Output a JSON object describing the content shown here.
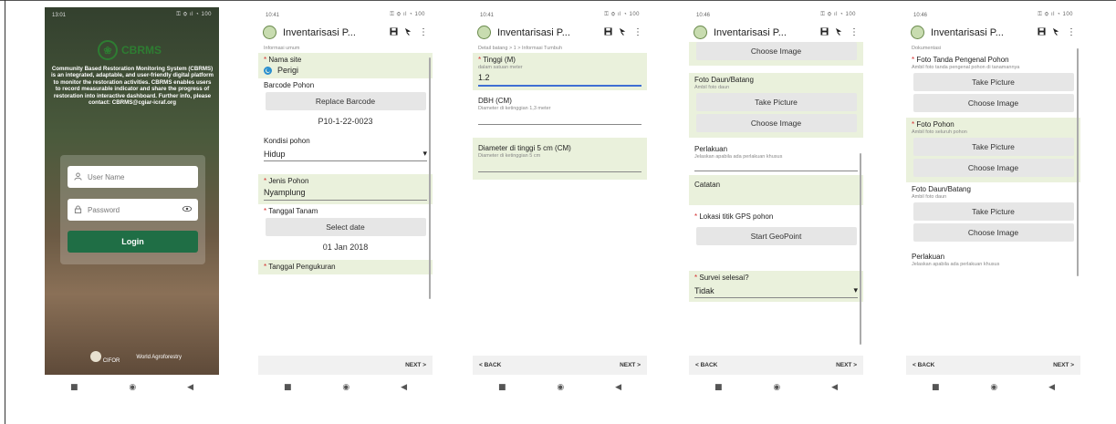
{
  "phones": {
    "login": {
      "status_time": "13:01",
      "status_icons": "⚿ ⚙ ıl ◔ 100",
      "brand_name": "CBRMS",
      "brand_mark": "❀",
      "description": "Community Based Restoration Monitoring System (CBRMS) is an integrated, adaptable, and user-friendly digital platform to monitor the restoration activities. CBRMS enables users to record measurable indicator and share the progress of restoration into interactive dashboard. Further info, please contact: CBRMS@cgiar-icraf.org",
      "username_placeholder": "User Name",
      "password_placeholder": "Password",
      "login_label": "Login",
      "logo_left": "CIFOR",
      "logo_right": "World Agroforestry",
      "user_icon": "person-icon",
      "lock_icon": "lock-icon",
      "eye_icon": "eye-icon"
    },
    "form1": {
      "status_time": "10:41",
      "title": "Inventarisasi P...",
      "section": "Informasi umum",
      "site_label": "Nama site",
      "site_value": "Perigi",
      "barcode_label": "Barcode Pohon",
      "replace_barcode": "Replace Barcode",
      "barcode_value": "P10-1-22-0023",
      "kondisi_label": "Kondisi pohon",
      "kondisi_value": "Hidup",
      "jenis_label": "Jenis Pohon",
      "jenis_value": "Nyamplung",
      "tanggal_label": "Tanggal Tanam",
      "select_date": "Select date",
      "tanggal_value": "01 Jan 2018",
      "pengukuran_label": "Tanggal Pengukuran",
      "next": "NEXT >"
    },
    "form2": {
      "status_time": "10:41",
      "title": "Inventarisasi P...",
      "section": "Detail batang > 1 > Informasi Tumbuh",
      "tinggi_label": "Tinggi (M)",
      "tinggi_hint": "dalam satuan meter",
      "tinggi_value": "1.2",
      "dbh_label": "DBH (CM)",
      "dbh_hint": "Diameter di ketinggian 1,3 meter",
      "diam_label": "Diameter di tinggi 5 cm (CM)",
      "diam_hint": "Diameter di ketinggian 5 cm",
      "back": "< BACK",
      "next": "NEXT >"
    },
    "form3": {
      "status_time": "10:46",
      "title": "Inventarisasi P...",
      "choose_top": "Choose Image",
      "foto_label": "Foto Daun/Batang",
      "foto_hint": "Ambil foto daun",
      "take_picture": "Take Picture",
      "choose_image": "Choose Image",
      "perlakuan_label": "Perlakuan",
      "perlakuan_hint": "Jelaskan apabila ada perlakuan khusus",
      "catatan_label": "Catatan",
      "gps_label": "Lokasi titik GPS pohon",
      "start_geopoint": "Start GeoPoint",
      "survei_label": "Survei selesai?",
      "survei_value": "Tidak",
      "back": "< BACK",
      "next": "NEXT >"
    },
    "form4": {
      "status_time": "10:46",
      "title": "Inventarisasi P...",
      "section": "Dokumentasi",
      "tanda_label": "Foto Tanda Pengenal Pohon",
      "tanda_hint": "Ambil foto tanda pengenal pohon di tanamannya",
      "take_picture": "Take Picture",
      "choose_image": "Choose Image",
      "pohon_label": "Foto Pohon",
      "pohon_hint": "Ambil foto seluruh pohon",
      "daun_label": "Foto Daun/Batang",
      "daun_hint": "Ambil foto daun",
      "perlakuan_label": "Perlakuan",
      "perlakuan_hint": "Jelaskan apabila ada perlakuan khusus",
      "back": "< BACK",
      "next": "NEXT >"
    }
  },
  "common": {
    "req_mark": "*",
    "save_icon": "save-icon",
    "flag_icon": "flag-icon",
    "menu_icon": "more-vert-icon",
    "dropdown_icon": "▾",
    "nav_square": "■",
    "nav_circle": "◉",
    "nav_back": "◀",
    "status_icons_form": "⚿ ⚙ ıl ◔ 100"
  },
  "colors": {
    "highlight": "#eaf1dc",
    "login_button": "#1f6e45",
    "radio": "#2a8fd0",
    "required": "#d32f2f",
    "brand_green": "#2e7d32"
  }
}
